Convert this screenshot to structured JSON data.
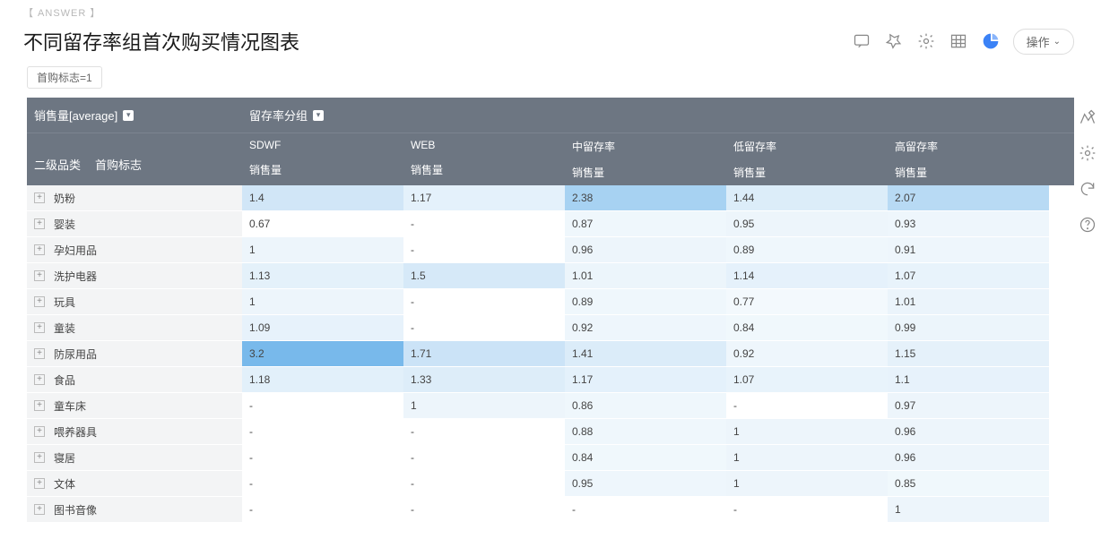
{
  "answer_tag": "【 ANSWER 】",
  "title": "不同留存率组首次购买情况图表",
  "ops_button": "操作",
  "filter": "首购标志=1",
  "metric_header": "销售量[average]",
  "group_header": "留存率分组",
  "dim1": "二级品类",
  "dim2": "首购标志",
  "sub_metric": "销售量",
  "columns": [
    "SDWF",
    "WEB",
    "中留存率",
    "低留存率",
    "高留存率"
  ],
  "rows": [
    {
      "label": "奶粉",
      "vals": [
        "1.4",
        "1.17",
        "2.38",
        "1.44",
        "2.07"
      ]
    },
    {
      "label": "婴装",
      "vals": [
        "0.67",
        "-",
        "0.87",
        "0.95",
        "0.93"
      ]
    },
    {
      "label": "孕妇用品",
      "vals": [
        "1",
        "-",
        "0.96",
        "0.89",
        "0.91"
      ]
    },
    {
      "label": "洗护电器",
      "vals": [
        "1.13",
        "1.5",
        "1.01",
        "1.14",
        "1.07"
      ]
    },
    {
      "label": "玩具",
      "vals": [
        "1",
        "-",
        "0.89",
        "0.77",
        "1.01"
      ]
    },
    {
      "label": "童装",
      "vals": [
        "1.09",
        "-",
        "0.92",
        "0.84",
        "0.99"
      ]
    },
    {
      "label": "防尿用品",
      "vals": [
        "3.2",
        "1.71",
        "1.41",
        "0.92",
        "1.15"
      ]
    },
    {
      "label": "食品",
      "vals": [
        "1.18",
        "1.33",
        "1.17",
        "1.07",
        "1.1"
      ]
    },
    {
      "label": "童车床",
      "vals": [
        "-",
        "1",
        "0.86",
        "-",
        "0.97"
      ]
    },
    {
      "label": "喂养器具",
      "vals": [
        "-",
        "-",
        "0.88",
        "1",
        "0.96"
      ]
    },
    {
      "label": "寝居",
      "vals": [
        "-",
        "-",
        "0.84",
        "1",
        "0.96"
      ]
    },
    {
      "label": "文体",
      "vals": [
        "-",
        "-",
        "0.95",
        "1",
        "0.85"
      ]
    },
    {
      "label": "图书音像",
      "vals": [
        "-",
        "-",
        "-",
        "-",
        "1"
      ]
    }
  ],
  "heat_colors": [
    [
      "#d1e6f7",
      "#e4f1fb",
      "#a7d2f2",
      "#dcedf9",
      "#b8daf4"
    ],
    [
      "#ffffff",
      "#ffffff",
      "#eff7fc",
      "#edf5fb",
      "#eef6fc"
    ],
    [
      "#edf5fb",
      "#ffffff",
      "#edf5fb",
      "#eff7fc",
      "#eef6fc"
    ],
    [
      "#e4f1fa",
      "#d6e9f8",
      "#ecf5fb",
      "#e5f1fb",
      "#e8f3fb"
    ],
    [
      "#edf5fb",
      "#ffffff",
      "#eff7fc",
      "#f3f9fd",
      "#ebf4fb"
    ],
    [
      "#e7f2fb",
      "#ffffff",
      "#eef6fc",
      "#f0f8fc",
      "#ecf5fb"
    ],
    [
      "#78b9eb",
      "#cbe3f7",
      "#dbecf9",
      "#eef6fc",
      "#e5f1fa"
    ],
    [
      "#e2f0fa",
      "#ddedf9",
      "#e4f1fb",
      "#e8f3fb",
      "#e7f2fb"
    ],
    [
      "#ffffff",
      "#edf5fb",
      "#eff7fc",
      "#ffffff",
      "#edf5fb"
    ],
    [
      "#ffffff",
      "#ffffff",
      "#eff7fc",
      "#edf5fb",
      "#edf5fb"
    ],
    [
      "#ffffff",
      "#ffffff",
      "#f0f8fc",
      "#edf5fb",
      "#edf5fb"
    ],
    [
      "#ffffff",
      "#ffffff",
      "#eef6fc",
      "#edf5fb",
      "#f0f8fc"
    ],
    [
      "#ffffff",
      "#ffffff",
      "#ffffff",
      "#ffffff",
      "#edf5fb"
    ]
  ]
}
